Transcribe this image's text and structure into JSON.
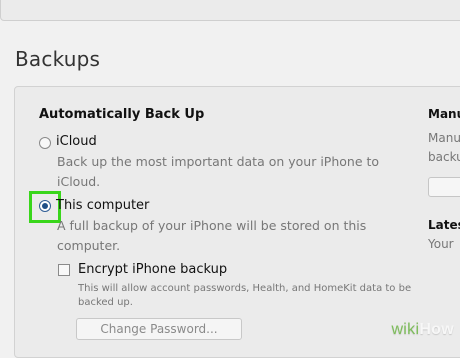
{
  "section": {
    "title": "Backups"
  },
  "group": {
    "title": "Automatically Back Up"
  },
  "options": {
    "icloud": {
      "label": "iCloud",
      "desc_line1": "Back up the most important data on your iPhone to",
      "desc_line2": "iCloud."
    },
    "computer": {
      "label": "This computer",
      "desc_line1": "A full backup of your iPhone will be stored on this",
      "desc_line2": "computer."
    }
  },
  "encrypt": {
    "label": "Encrypt iPhone backup",
    "desc_line1": "This will allow account passwords, Health, and HomeKit data to be",
    "desc_line2": "backed up.",
    "button_label": "Change Password..."
  },
  "right_column": {
    "title1": "Manu",
    "desc1_line1": "Manu",
    "desc1_line2": "backu",
    "title2": "Lates",
    "desc2_line1": "Your"
  },
  "watermark": {
    "wiki": "wiki",
    "how": "How"
  }
}
